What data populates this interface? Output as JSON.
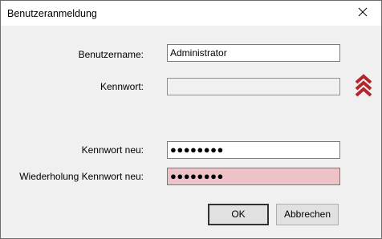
{
  "window": {
    "title": "Benutzeranmeldung",
    "close_icon": "close-icon"
  },
  "form": {
    "username": {
      "label": "Benutzername:",
      "value": "Administrator"
    },
    "password": {
      "label": "Kennwort:",
      "value": ""
    },
    "new_password": {
      "label": "Kennwort neu:",
      "value": "●●●●●●●●"
    },
    "repeat_password": {
      "label": "Wiederholung Kennwort neu:",
      "value": "●●●●●●●●"
    },
    "expand_icon": "double-chevron-up-icon"
  },
  "buttons": {
    "ok_label": "OK",
    "cancel_label": "Abbrechen"
  },
  "colors": {
    "chevron": "#b3262d",
    "invalid_field": "#eec3c8",
    "dialog_bg": "#f0f0f0"
  }
}
